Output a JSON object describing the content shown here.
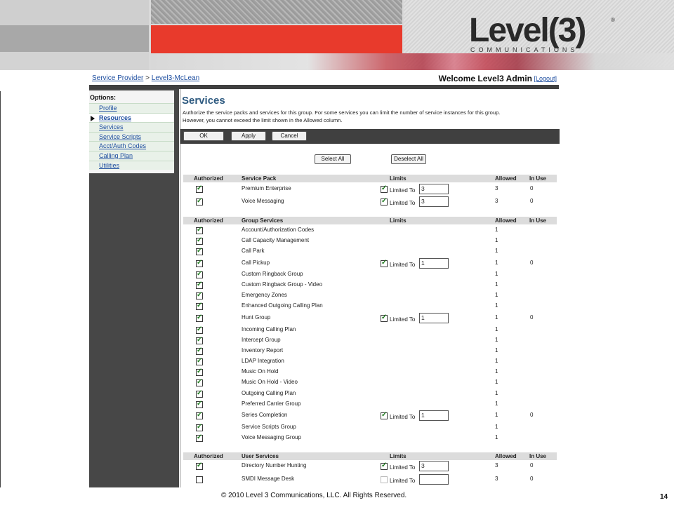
{
  "brand": {
    "logo_text": "Level(3)",
    "logo_sub": "COMMUNICATIONS",
    "logo_reg": "®"
  },
  "breadcrumb": {
    "provider": "Service Provider",
    "sep": ">",
    "group": "Level3-McLean"
  },
  "header": {
    "welcome": "Welcome Level3 Admin",
    "logout": "[Logout]"
  },
  "nav": {
    "title": "Options:",
    "items": [
      {
        "label": "Profile",
        "active": false
      },
      {
        "label": "Resources",
        "active": true
      },
      {
        "label": "Services",
        "active": false
      },
      {
        "label": "Service Scripts",
        "active": false
      },
      {
        "label": "Acct/Auth Codes",
        "active": false
      },
      {
        "label": "Calling Plan",
        "active": false
      },
      {
        "label": "Utilities",
        "active": false
      }
    ]
  },
  "page": {
    "title": "Services",
    "description_line1": "Authorize the service packs and services for this group. For some services you can limit the number of service instances for this group.",
    "description_line2": "However, you cannot exceed the limit shown in the Allowed column."
  },
  "toolbar": {
    "ok": "OK",
    "apply": "Apply",
    "cancel": "Cancel"
  },
  "selection": {
    "select_all": "Select All",
    "deselect_all": "Deselect All"
  },
  "columns": {
    "authorized": "Authorized",
    "limits": "Limits",
    "allowed": "Allowed",
    "in_use": "In Use",
    "limited_to": "Limited To"
  },
  "sections": [
    {
      "heading": "Service Pack",
      "rows": [
        {
          "name": "Premium Enterprise",
          "authorized": true,
          "limited": true,
          "limit": "3",
          "allowed": "3",
          "in_use": "0"
        },
        {
          "name": "Voice Messaging",
          "authorized": true,
          "limited": true,
          "limit": "3",
          "allowed": "3",
          "in_use": "0"
        }
      ]
    },
    {
      "heading": "Group Services",
      "rows": [
        {
          "name": "Account/Authorization Codes",
          "authorized": true,
          "allowed": "1"
        },
        {
          "name": "Call Capacity Management",
          "authorized": true,
          "allowed": "1"
        },
        {
          "name": "Call Park",
          "authorized": true,
          "allowed": "1"
        },
        {
          "name": "Call Pickup",
          "authorized": true,
          "limited": true,
          "limit": "1",
          "allowed": "1",
          "in_use": "0"
        },
        {
          "name": "Custom Ringback Group",
          "authorized": true,
          "allowed": "1"
        },
        {
          "name": "Custom Ringback Group - Video",
          "authorized": true,
          "allowed": "1"
        },
        {
          "name": "Emergency Zones",
          "authorized": true,
          "allowed": "1"
        },
        {
          "name": "Enhanced Outgoing Calling Plan",
          "authorized": true,
          "allowed": "1"
        },
        {
          "name": "Hunt Group",
          "authorized": true,
          "limited": true,
          "limit": "1",
          "allowed": "1",
          "in_use": "0"
        },
        {
          "name": "Incoming Calling Plan",
          "authorized": true,
          "allowed": "1"
        },
        {
          "name": "Intercept Group",
          "authorized": true,
          "allowed": "1"
        },
        {
          "name": "Inventory Report",
          "authorized": true,
          "allowed": "1"
        },
        {
          "name": "LDAP Integration",
          "authorized": true,
          "allowed": "1"
        },
        {
          "name": "Music On Hold",
          "authorized": true,
          "allowed": "1"
        },
        {
          "name": "Music On Hold - Video",
          "authorized": true,
          "allowed": "1"
        },
        {
          "name": "Outgoing Calling Plan",
          "authorized": true,
          "allowed": "1"
        },
        {
          "name": "Preferred Carrier Group",
          "authorized": true,
          "allowed": "1"
        },
        {
          "name": "Series Completion",
          "authorized": true,
          "limited": true,
          "limit": "1",
          "allowed": "1",
          "in_use": "0"
        },
        {
          "name": "Service Scripts Group",
          "authorized": true,
          "allowed": "1"
        },
        {
          "name": "Voice Messaging Group",
          "authorized": true,
          "allowed": "1"
        }
      ]
    },
    {
      "heading": "User Services",
      "rows": [
        {
          "name": "Directory Number Hunting",
          "authorized": true,
          "limited": true,
          "limit": "3",
          "allowed": "3",
          "in_use": "0"
        },
        {
          "name": "SMDI Message Desk",
          "authorized": false,
          "limited": false,
          "limit": "",
          "limit_disabled": true,
          "allowed": "3",
          "in_use": "0"
        }
      ]
    }
  ],
  "footer": {
    "copyright": "© 2010 Level 3 Communications, LLC. All Rights Reserved.",
    "page_number": "14"
  }
}
